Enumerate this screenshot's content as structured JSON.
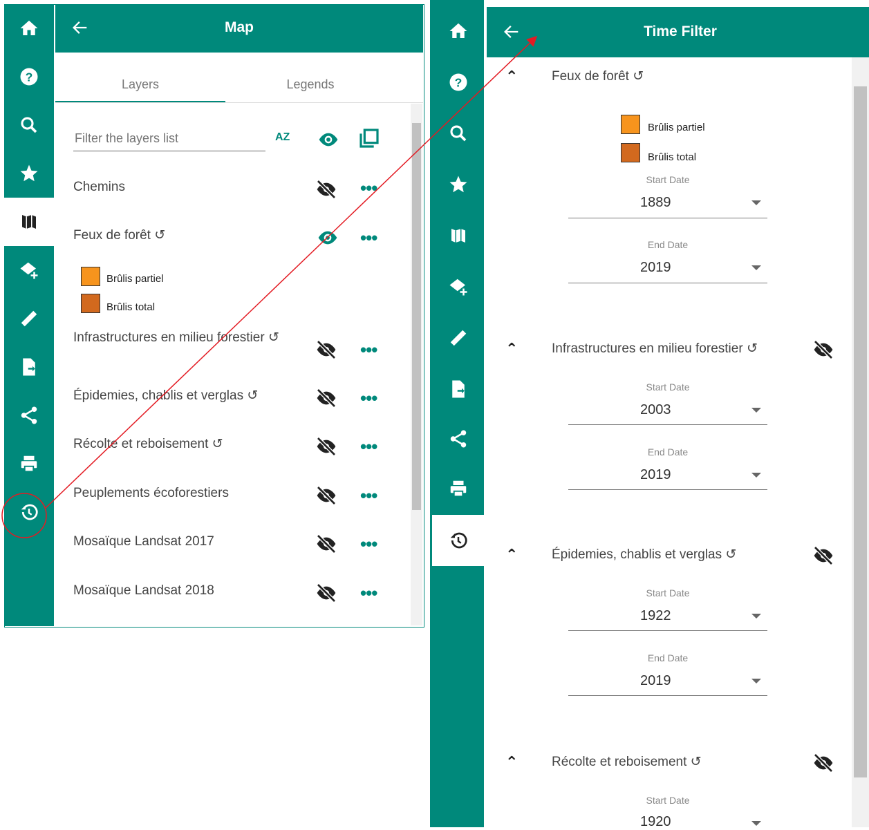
{
  "left_panel": {
    "header_title": "Map",
    "tabs": [
      {
        "label": "Layers"
      },
      {
        "label": "Legends"
      }
    ],
    "filter_placeholder": "Filter the layers list",
    "sort_label": "AZ",
    "layers": [
      {
        "name": "Chemins",
        "visible": false
      },
      {
        "name": "Feux de forêt ↺",
        "visible": true
      },
      {
        "name": "Infrastructures en milieu forestier ↺",
        "visible": false
      },
      {
        "name": "Épidemies, chablis et verglas ↺",
        "visible": false
      },
      {
        "name": "Récolte et reboisement ↺",
        "visible": false
      },
      {
        "name": "Peuplements écoforestiers",
        "visible": false
      },
      {
        "name": "Mosaïque Landsat 2017",
        "visible": false
      },
      {
        "name": "Mosaïque Landsat 2018",
        "visible": false
      }
    ],
    "legend": [
      {
        "label": "Brûlis partiel",
        "color": "#f7941d"
      },
      {
        "label": "Brûlis total",
        "color": "#d2691e"
      }
    ],
    "more_label": "•••"
  },
  "sidebar_icons": [
    "home-icon",
    "help-icon",
    "search-icon",
    "star-icon",
    "map-icon",
    "add-layer-icon",
    "ruler-icon",
    "export-icon",
    "share-icon",
    "print-icon",
    "history-icon"
  ],
  "right_panel": {
    "header_title": "Time Filter",
    "groups": [
      {
        "name": "Feux de forêt ↺",
        "legend": [
          {
            "label": "Brûlis partiel",
            "color": "#f7941d"
          },
          {
            "label": "Brûlis total",
            "color": "#d2691e"
          }
        ],
        "start_label": "Start Date",
        "start": "1889",
        "end_label": "End Date",
        "end": "2019"
      },
      {
        "name": "Infrastructures en milieu forestier ↺",
        "start_label": "Start Date",
        "start": "2003",
        "end_label": "End Date",
        "end": "2019"
      },
      {
        "name": "Épidemies, chablis et verglas ↺",
        "start_label": "Start Date",
        "start": "1922",
        "end_label": "End Date",
        "end": "2019"
      },
      {
        "name": "Récolte et reboisement ↺",
        "start_label": "Start Date",
        "start": "1920"
      }
    ]
  },
  "colors": {
    "primary": "#00897b",
    "annotation": "#e31b23"
  }
}
